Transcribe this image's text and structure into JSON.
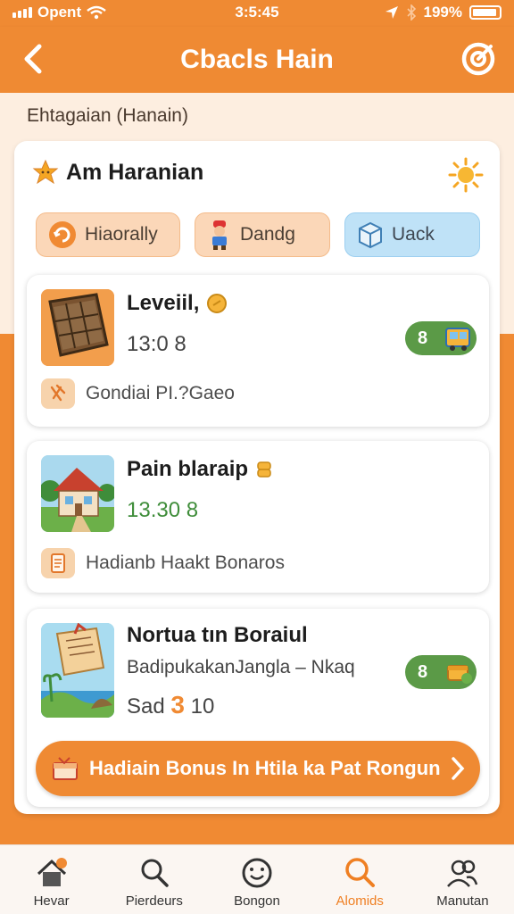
{
  "status": {
    "carrier": "Opent",
    "time": "3:5:45",
    "battery": "199%"
  },
  "header": {
    "title": "Cbacls Hain"
  },
  "subtitle": "Ehtagaian (Hanain)",
  "panel": {
    "title": "Am Haranian",
    "chips": [
      {
        "label": "Hiaorally"
      },
      {
        "label": "Dandg"
      },
      {
        "label": "Uack"
      }
    ]
  },
  "cards": [
    {
      "name": "Leveiil,",
      "value": "13:0 8",
      "pill": "8",
      "footer": "Gondiai PI.?Gaeo"
    },
    {
      "name": "Pain blaraip",
      "value": "13.30 8",
      "footer": "Hadianb Haakt Bonaros"
    },
    {
      "name": "Nortua tın Boraiul",
      "desc": "BadipukakanJangla – Nkaq",
      "value_prefix": "Sad",
      "value_accent": "3",
      "value_suffix": "10",
      "pill": "8"
    }
  ],
  "cta": {
    "label": "Hadiain Bonus In Htila ka Pat Rongun"
  },
  "tabs": [
    {
      "label": "Hevar",
      "icon": "home-icon"
    },
    {
      "label": "Pierdeurs",
      "icon": "search-people-icon"
    },
    {
      "label": "Bongon",
      "icon": "smiley-icon"
    },
    {
      "label": "Alomids",
      "icon": "search-icon",
      "active": true
    },
    {
      "label": "Manutan",
      "icon": "users-icon"
    }
  ],
  "colors": {
    "accent": "#ef8a33",
    "green": "#5b9a47",
    "cream": "#fdeee0"
  }
}
